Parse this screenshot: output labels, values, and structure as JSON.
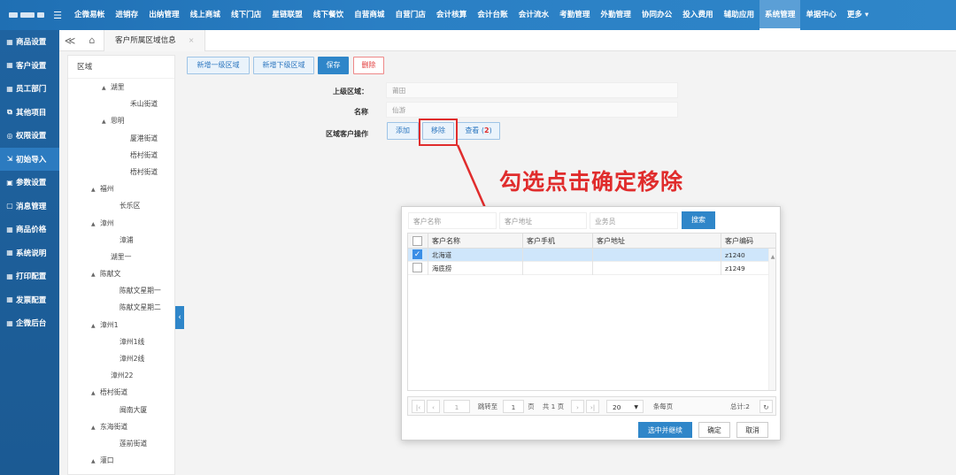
{
  "topnav": {
    "items": [
      "企微易帐",
      "进销存",
      "出纳管理",
      "线上商城",
      "线下门店",
      "星链联盟",
      "线下餐饮",
      "自营商城",
      "自营门店",
      "会计核算",
      "会计台账",
      "会计流水",
      "考勤管理",
      "外勤管理",
      "协同办公",
      "投入费用",
      "辅助应用",
      "系统管理",
      "单据中心",
      "更多 ▾"
    ],
    "active": "系统管理",
    "menu_icon": "☰"
  },
  "sidebar": {
    "items": [
      {
        "icon": "▦",
        "label": "商品设置"
      },
      {
        "icon": "▦",
        "label": "客户设置"
      },
      {
        "icon": "▦",
        "label": "员工部门"
      },
      {
        "icon": "⧉",
        "label": "其他项目"
      },
      {
        "icon": "◎",
        "label": "权限设置"
      },
      {
        "icon": "⇲",
        "label": "初始导入"
      },
      {
        "icon": "▣",
        "label": "参数设置"
      },
      {
        "icon": "▢",
        "label": "消息管理"
      },
      {
        "icon": "▦",
        "label": "商品价格"
      },
      {
        "icon": "▦",
        "label": "系统说明"
      },
      {
        "icon": "▦",
        "label": "打印配置"
      },
      {
        "icon": "▦",
        "label": "发票配置"
      },
      {
        "icon": "▦",
        "label": "企微后台"
      }
    ],
    "active_index": 5
  },
  "tabs": {
    "back": "≪",
    "home_icon": "⌂",
    "items": [
      {
        "label": "客户所属区域信息",
        "close": "×"
      }
    ]
  },
  "tree": {
    "header": "区域",
    "nodes": [
      {
        "label": "湖里",
        "indent": 38,
        "arrow": "▲"
      },
      {
        "label": "禾山街道",
        "indent": 60,
        "arrow": ""
      },
      {
        "label": "思明",
        "indent": 38,
        "arrow": "▲"
      },
      {
        "label": "厦港街道",
        "indent": 60,
        "arrow": ""
      },
      {
        "label": "梧村街道",
        "indent": 60,
        "arrow": ""
      },
      {
        "label": "梧村街道",
        "indent": 60,
        "arrow": ""
      },
      {
        "label": "福州",
        "indent": 26,
        "arrow": "▲"
      },
      {
        "label": "长乐区",
        "indent": 48,
        "arrow": ""
      },
      {
        "label": "漳州",
        "indent": 26,
        "arrow": "▲"
      },
      {
        "label": "漳浦",
        "indent": 48,
        "arrow": ""
      },
      {
        "label": "湖里一",
        "indent": 38,
        "arrow": ""
      },
      {
        "label": "陈献文",
        "indent": 26,
        "arrow": "▲"
      },
      {
        "label": "陈献文星期一",
        "indent": 48,
        "arrow": ""
      },
      {
        "label": "陈献文星期二",
        "indent": 48,
        "arrow": ""
      },
      {
        "label": "漳州1",
        "indent": 26,
        "arrow": "▲"
      },
      {
        "label": "漳州1线",
        "indent": 48,
        "arrow": ""
      },
      {
        "label": "漳州2线",
        "indent": 48,
        "arrow": ""
      },
      {
        "label": "漳州22",
        "indent": 38,
        "arrow": ""
      },
      {
        "label": "梧村街道",
        "indent": 26,
        "arrow": "▲"
      },
      {
        "label": "闽南大厦",
        "indent": 48,
        "arrow": ""
      },
      {
        "label": "东海街道",
        "indent": 26,
        "arrow": "▲"
      },
      {
        "label": "莲前街道",
        "indent": 48,
        "arrow": ""
      },
      {
        "label": "灌口",
        "indent": 26,
        "arrow": "▲"
      }
    ]
  },
  "toolbar": {
    "add_top": "新增一级区域",
    "add_sub": "新增下级区域",
    "save": "保存",
    "delete": "删除"
  },
  "form": {
    "parent_label": "上级区域：",
    "parent_value": "莆田",
    "name_label": "名称",
    "name_value": "仙游",
    "ops_label": "区域客户操作",
    "op_add": "添加",
    "op_remove": "移除",
    "op_view_prefix": "查看 (",
    "op_view_count": "2",
    "op_view_suffix": ")"
  },
  "annotation": "勾选点击确定移除",
  "dialog": {
    "search": {
      "name_ph": "客户名称",
      "addr_ph": "客户地址",
      "staff_ph": "业务员",
      "button": "搜索"
    },
    "columns": [
      "客户名称",
      "客户手机",
      "客户地址",
      "客户编码"
    ],
    "rows": [
      {
        "name": "北海道",
        "phone": "",
        "addr": "",
        "code": "z1240",
        "checked": true
      },
      {
        "name": "海底捞",
        "phone": "",
        "addr": "",
        "code": "z1249",
        "checked": false
      }
    ],
    "pager": {
      "page": "1",
      "jump_label": "跳转至",
      "jump_value": "1",
      "page_unit": "页",
      "total_pages": "共 1 页",
      "page_size": "20",
      "per_page": "条每页",
      "total": "总计:2"
    },
    "buttons": {
      "select_continue": "选中并继续",
      "ok": "确定",
      "cancel": "取消"
    }
  }
}
